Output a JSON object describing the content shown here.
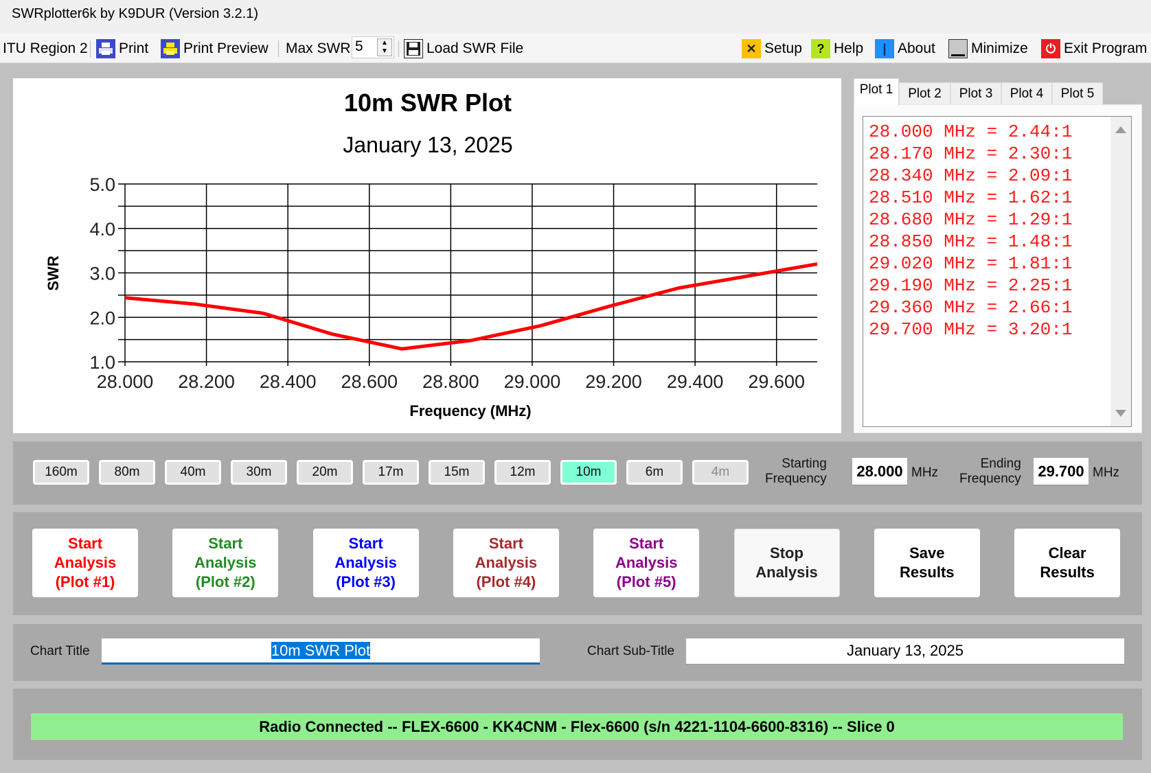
{
  "window": {
    "title": "SWRplotter6k by K9DUR (Version 3.2.1)"
  },
  "toolbar": {
    "region": "ITU Region 2",
    "print": "Print",
    "print_preview": "Print Preview",
    "max_swr_label": "Max SWR",
    "max_swr_value": "5",
    "load_swr_file": "Load SWR File",
    "setup": "Setup",
    "help": "Help",
    "about": "About",
    "minimize": "Minimize",
    "exit": "Exit Program",
    "icons": {
      "print": "printer-icon",
      "print_preview": "print-preview-icon",
      "load": "floppy-disk-icon",
      "setup": "tools-icon",
      "help": "question-icon",
      "about": "info-icon",
      "minimize": "minimize-icon",
      "exit": "power-icon"
    },
    "colors": {
      "setup": "#ffc000",
      "help": "#b5e61d",
      "about": "#1e90ff",
      "minimize": "#c8c8c8",
      "exit": "#ed1c24",
      "print": "#3f48cc"
    }
  },
  "tabs": [
    "Plot 1",
    "Plot 2",
    "Plot 3",
    "Plot 4",
    "Plot 5"
  ],
  "active_tab": 0,
  "results": [
    "28.000 MHz = 2.44:1",
    "28.170 MHz = 2.30:1",
    "28.340 MHz = 2.09:1",
    "28.510 MHz = 1.62:1",
    "28.680 MHz = 1.29:1",
    "28.850 MHz = 1.48:1",
    "29.020 MHz = 1.81:1",
    "29.190 MHz = 2.25:1",
    "29.360 MHz = 2.66:1",
    "29.700 MHz = 3.20:1"
  ],
  "bands": [
    {
      "label": "160m",
      "state": "normal"
    },
    {
      "label": "80m",
      "state": "normal"
    },
    {
      "label": "40m",
      "state": "normal"
    },
    {
      "label": "30m",
      "state": "normal"
    },
    {
      "label": "20m",
      "state": "normal"
    },
    {
      "label": "17m",
      "state": "normal"
    },
    {
      "label": "15m",
      "state": "normal"
    },
    {
      "label": "12m",
      "state": "normal"
    },
    {
      "label": "10m",
      "state": "selected"
    },
    {
      "label": "6m",
      "state": "normal"
    },
    {
      "label": "4m",
      "state": "disabled"
    }
  ],
  "frequency": {
    "start_label_1": "Starting",
    "start_label_2": "Frequency",
    "start_value": "28.000",
    "end_label_1": "Ending",
    "end_label_2": "Frequency",
    "end_value": "29.700",
    "unit": "MHz"
  },
  "actions": [
    {
      "lines": [
        "Start",
        "Analysis",
        "(Plot #1)"
      ],
      "color": "#ff0000"
    },
    {
      "lines": [
        "Start",
        "Analysis",
        "(Plot #2)"
      ],
      "color": "#228b22"
    },
    {
      "lines": [
        "Start",
        "Analysis",
        "(Plot #3)"
      ],
      "color": "#0000ff"
    },
    {
      "lines": [
        "Start",
        "Analysis",
        "(Plot #4)"
      ],
      "color": "#a52a2a"
    },
    {
      "lines": [
        "Start",
        "Analysis",
        "(Plot #5)"
      ],
      "color": "#8b008b"
    },
    {
      "lines": [
        "Stop",
        "Analysis"
      ],
      "color": "#222222"
    },
    {
      "lines": [
        "Save",
        "Results"
      ],
      "color": "#000000"
    },
    {
      "lines": [
        "Clear",
        "Results"
      ],
      "color": "#000000"
    }
  ],
  "chart_title_label": "Chart Title",
  "chart_title_value": "10m SWR Plot",
  "chart_subtitle_label": "Chart Sub-Title",
  "chart_subtitle_value": "January 13, 2025",
  "status": "Radio Connected -- FLEX-6600 - KK4CNM - Flex-6600  (s/n 4221-1104-6600-8316) -- Slice 0",
  "chart_data": {
    "type": "line",
    "title": "10m SWR Plot",
    "subtitle": "January 13, 2025",
    "xlabel": "Frequency (MHz)",
    "ylabel": "SWR",
    "xlim": [
      28.0,
      29.7
    ],
    "ylim": [
      1.0,
      5.0
    ],
    "xticks": [
      "28.000",
      "28.200",
      "28.400",
      "28.600",
      "28.800",
      "29.000",
      "29.200",
      "29.400",
      "29.600"
    ],
    "xtick_values": [
      28.0,
      28.2,
      28.4,
      28.6,
      28.8,
      29.0,
      29.2,
      29.4,
      29.6
    ],
    "yticks": [
      "1.0",
      "2.0",
      "3.0",
      "4.0",
      "5.0"
    ],
    "ytick_values": [
      1,
      2,
      3,
      4,
      5
    ],
    "minor_y_grid": [
      1.5,
      2.5,
      3.5,
      4.5
    ],
    "grid": true,
    "series": [
      {
        "name": "Plot 1",
        "color": "#ff0000",
        "x": [
          28.0,
          28.17,
          28.34,
          28.51,
          28.68,
          28.85,
          29.02,
          29.19,
          29.36,
          29.7
        ],
        "y": [
          2.44,
          2.3,
          2.09,
          1.62,
          1.29,
          1.48,
          1.81,
          2.25,
          2.66,
          3.2
        ]
      }
    ]
  }
}
